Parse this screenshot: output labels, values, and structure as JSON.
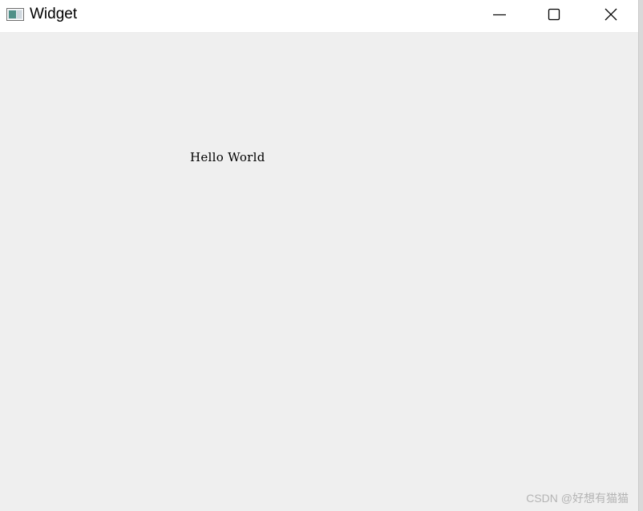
{
  "window": {
    "title": "Widget",
    "app_icon": "qt-window-icon",
    "controls": {
      "minimize": "minimize-icon",
      "maximize": "maximize-icon",
      "close": "close-icon"
    }
  },
  "content": {
    "label_text": "Hello World"
  },
  "watermark": {
    "text": "CSDN @好想有猫猫"
  },
  "colors": {
    "titlebar": "#ffffff",
    "client_background": "#efefef",
    "text": "#000000",
    "watermark": "#b4b4b4"
  }
}
